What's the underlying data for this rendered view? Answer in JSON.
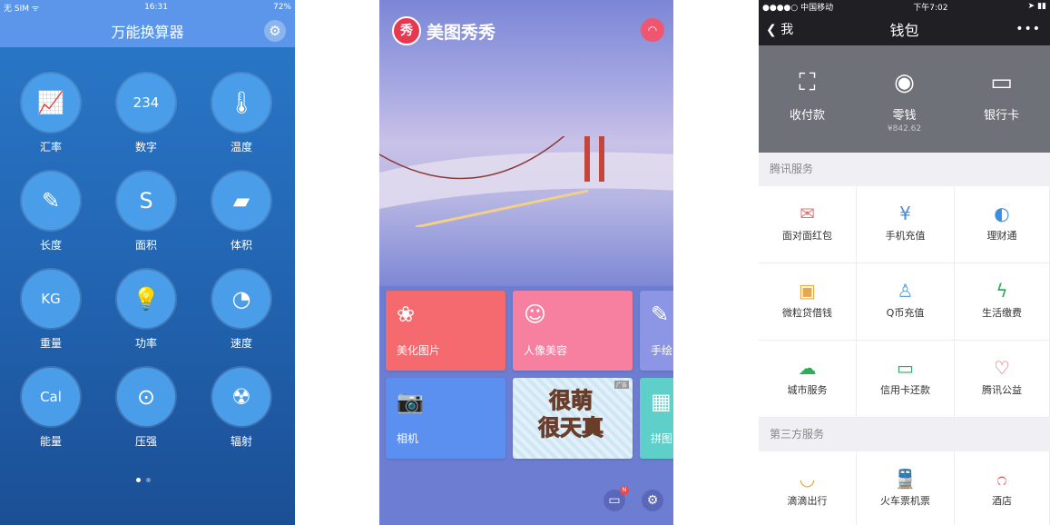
{
  "converter": {
    "status": {
      "carrier": "无 SIM ᯤ",
      "time": "16:31",
      "battery": "72%"
    },
    "title": "万能换算器",
    "items": [
      {
        "label": "汇率",
        "icon": "exchange-rate-chart-icon",
        "glyph": "📈"
      },
      {
        "label": "数字",
        "icon": "calendar-digits-icon",
        "glyph": "234"
      },
      {
        "label": "温度",
        "icon": "thermometer-icon",
        "glyph": "🌡"
      },
      {
        "label": "长度",
        "icon": "ruler-pencil-icon",
        "glyph": "✎"
      },
      {
        "label": "面积",
        "icon": "area-icon",
        "glyph": "S"
      },
      {
        "label": "体积",
        "icon": "eraser-volume-icon",
        "glyph": "▰"
      },
      {
        "label": "重量",
        "icon": "weight-kg-icon",
        "glyph": "KG"
      },
      {
        "label": "功率",
        "icon": "lightbulb-icon",
        "glyph": "💡"
      },
      {
        "label": "速度",
        "icon": "speedometer-icon",
        "glyph": "◔"
      },
      {
        "label": "能量",
        "icon": "chicken-cal-icon",
        "glyph": "Cal"
      },
      {
        "label": "压强",
        "icon": "pressure-gauge-icon",
        "glyph": "⊙"
      },
      {
        "label": "辐射",
        "icon": "radiation-icon",
        "glyph": "☢"
      }
    ],
    "page_count": 2,
    "current_page": 1
  },
  "meitu": {
    "logo_text": "美图秀秀",
    "logo_badge": "秀",
    "tiles": [
      {
        "label": "美化图片",
        "icon": "beautify-icon",
        "glyph": "❀",
        "color": "#f46a6f"
      },
      {
        "label": "人像美容",
        "icon": "portrait-icon",
        "glyph": "☺",
        "color": "#f77f9f"
      },
      {
        "label": "手绘",
        "icon": "hand-draw-icon",
        "glyph": "✎",
        "color": "#8c96e4"
      },
      {
        "label": "相机",
        "icon": "camera-icon",
        "glyph": "📷",
        "color": "#5b8ff0"
      },
      {
        "label": "拼图",
        "icon": "collage-icon",
        "glyph": "▦",
        "color": "#5fd0c9"
      }
    ],
    "ad": {
      "line1": "很萌",
      "line2": "很天真",
      "tag": "广告"
    },
    "badge": "N"
  },
  "wallet": {
    "status": {
      "carrier": "●●●●○ 中国移动",
      "time": "下午7:02"
    },
    "back": "我",
    "title": "钱包",
    "more": "•••",
    "top": [
      {
        "label": "收付款",
        "icon": "scan-pay-icon",
        "glyph": "⛶"
      },
      {
        "label": "零钱",
        "icon": "change-coin-icon",
        "glyph": "◉",
        "sub": "¥842.62"
      },
      {
        "label": "银行卡",
        "icon": "bank-card-icon",
        "glyph": "▭"
      }
    ],
    "section1": "腾讯服务",
    "services": [
      {
        "label": "面对面红包",
        "icon": "red-packet-icon",
        "glyph": "✉",
        "color": "#e8736f"
      },
      {
        "label": "手机充值",
        "icon": "mobile-topup-icon",
        "glyph": "¥",
        "color": "#4a8cd6"
      },
      {
        "label": "理财通",
        "icon": "wealth-icon",
        "glyph": "◐",
        "color": "#3c8fe0"
      },
      {
        "label": "微粒贷借钱",
        "icon": "loan-icon",
        "glyph": "▣",
        "color": "#e7a84a"
      },
      {
        "label": "Q币充值",
        "icon": "qq-penguin-icon",
        "glyph": "♙",
        "color": "#5aa4d8"
      },
      {
        "label": "生活缴费",
        "icon": "utility-bolt-icon",
        "glyph": "ϟ",
        "color": "#2fae5a"
      },
      {
        "label": "城市服务",
        "icon": "city-cloud-icon",
        "glyph": "☁",
        "color": "#2fae5a"
      },
      {
        "label": "信用卡还款",
        "icon": "credit-card-icon",
        "glyph": "▭",
        "color": "#2fae5a"
      },
      {
        "label": "腾讯公益",
        "icon": "charity-heart-icon",
        "glyph": "♡",
        "color": "#e0585c"
      }
    ],
    "section2": "第三方服务",
    "third": [
      {
        "label": "滴滴出行",
        "icon": "didi-icon",
        "glyph": "◡",
        "color": "#f0a030"
      },
      {
        "label": "火车票机票",
        "icon": "train-icon",
        "glyph": "🚆",
        "color": "#2fae5a"
      },
      {
        "label": "酒店",
        "icon": "hotel-icon",
        "glyph": "೧",
        "color": "#e0585c"
      }
    ]
  }
}
